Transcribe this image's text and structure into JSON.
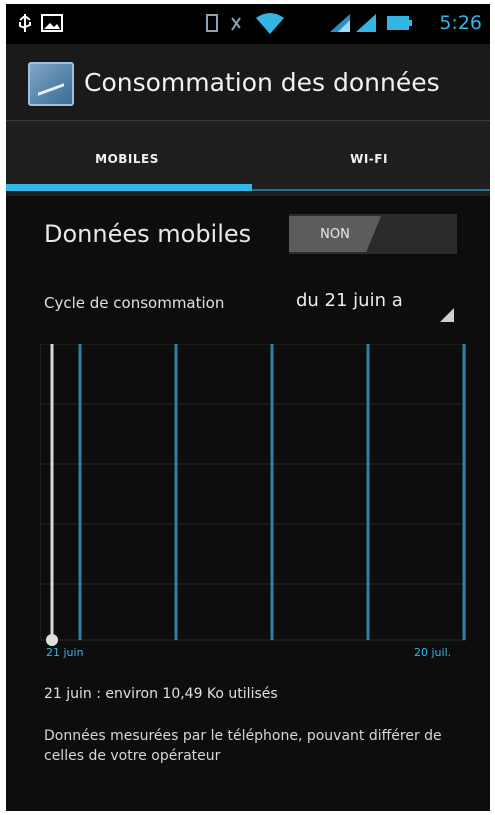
{
  "status_bar": {
    "time": "5:26",
    "icons": [
      "usb-icon",
      "image-icon",
      "vibrate-icon",
      "headset-icon",
      "wifi-icon",
      "signal-icon",
      "signal-icon",
      "battery-icon"
    ]
  },
  "action_bar": {
    "title": "Consommation des données",
    "app_icon": "data-usage-app-icon"
  },
  "tabs": [
    {
      "label": "MOBILES",
      "selected": true
    },
    {
      "label": "WI-FI",
      "selected": false
    }
  ],
  "mobile_data": {
    "label": "Données mobiles",
    "toggle_state": "NON"
  },
  "cycle": {
    "label": "Cycle de consommation",
    "value": "du 21 juin a"
  },
  "chart": {
    "start_label": "21 juin",
    "end_label": "20 juil."
  },
  "summary": "21 juin : environ 10,49 Ko utilisés",
  "disclaimer": "Données mesurées par le téléphone, pouvant différer de celles de votre opérateur",
  "colors": {
    "accent": "#33b5e5",
    "background": "#0d0d0d",
    "action_bar": "#1a1a1a",
    "tab_bar": "#1f1f1f"
  }
}
